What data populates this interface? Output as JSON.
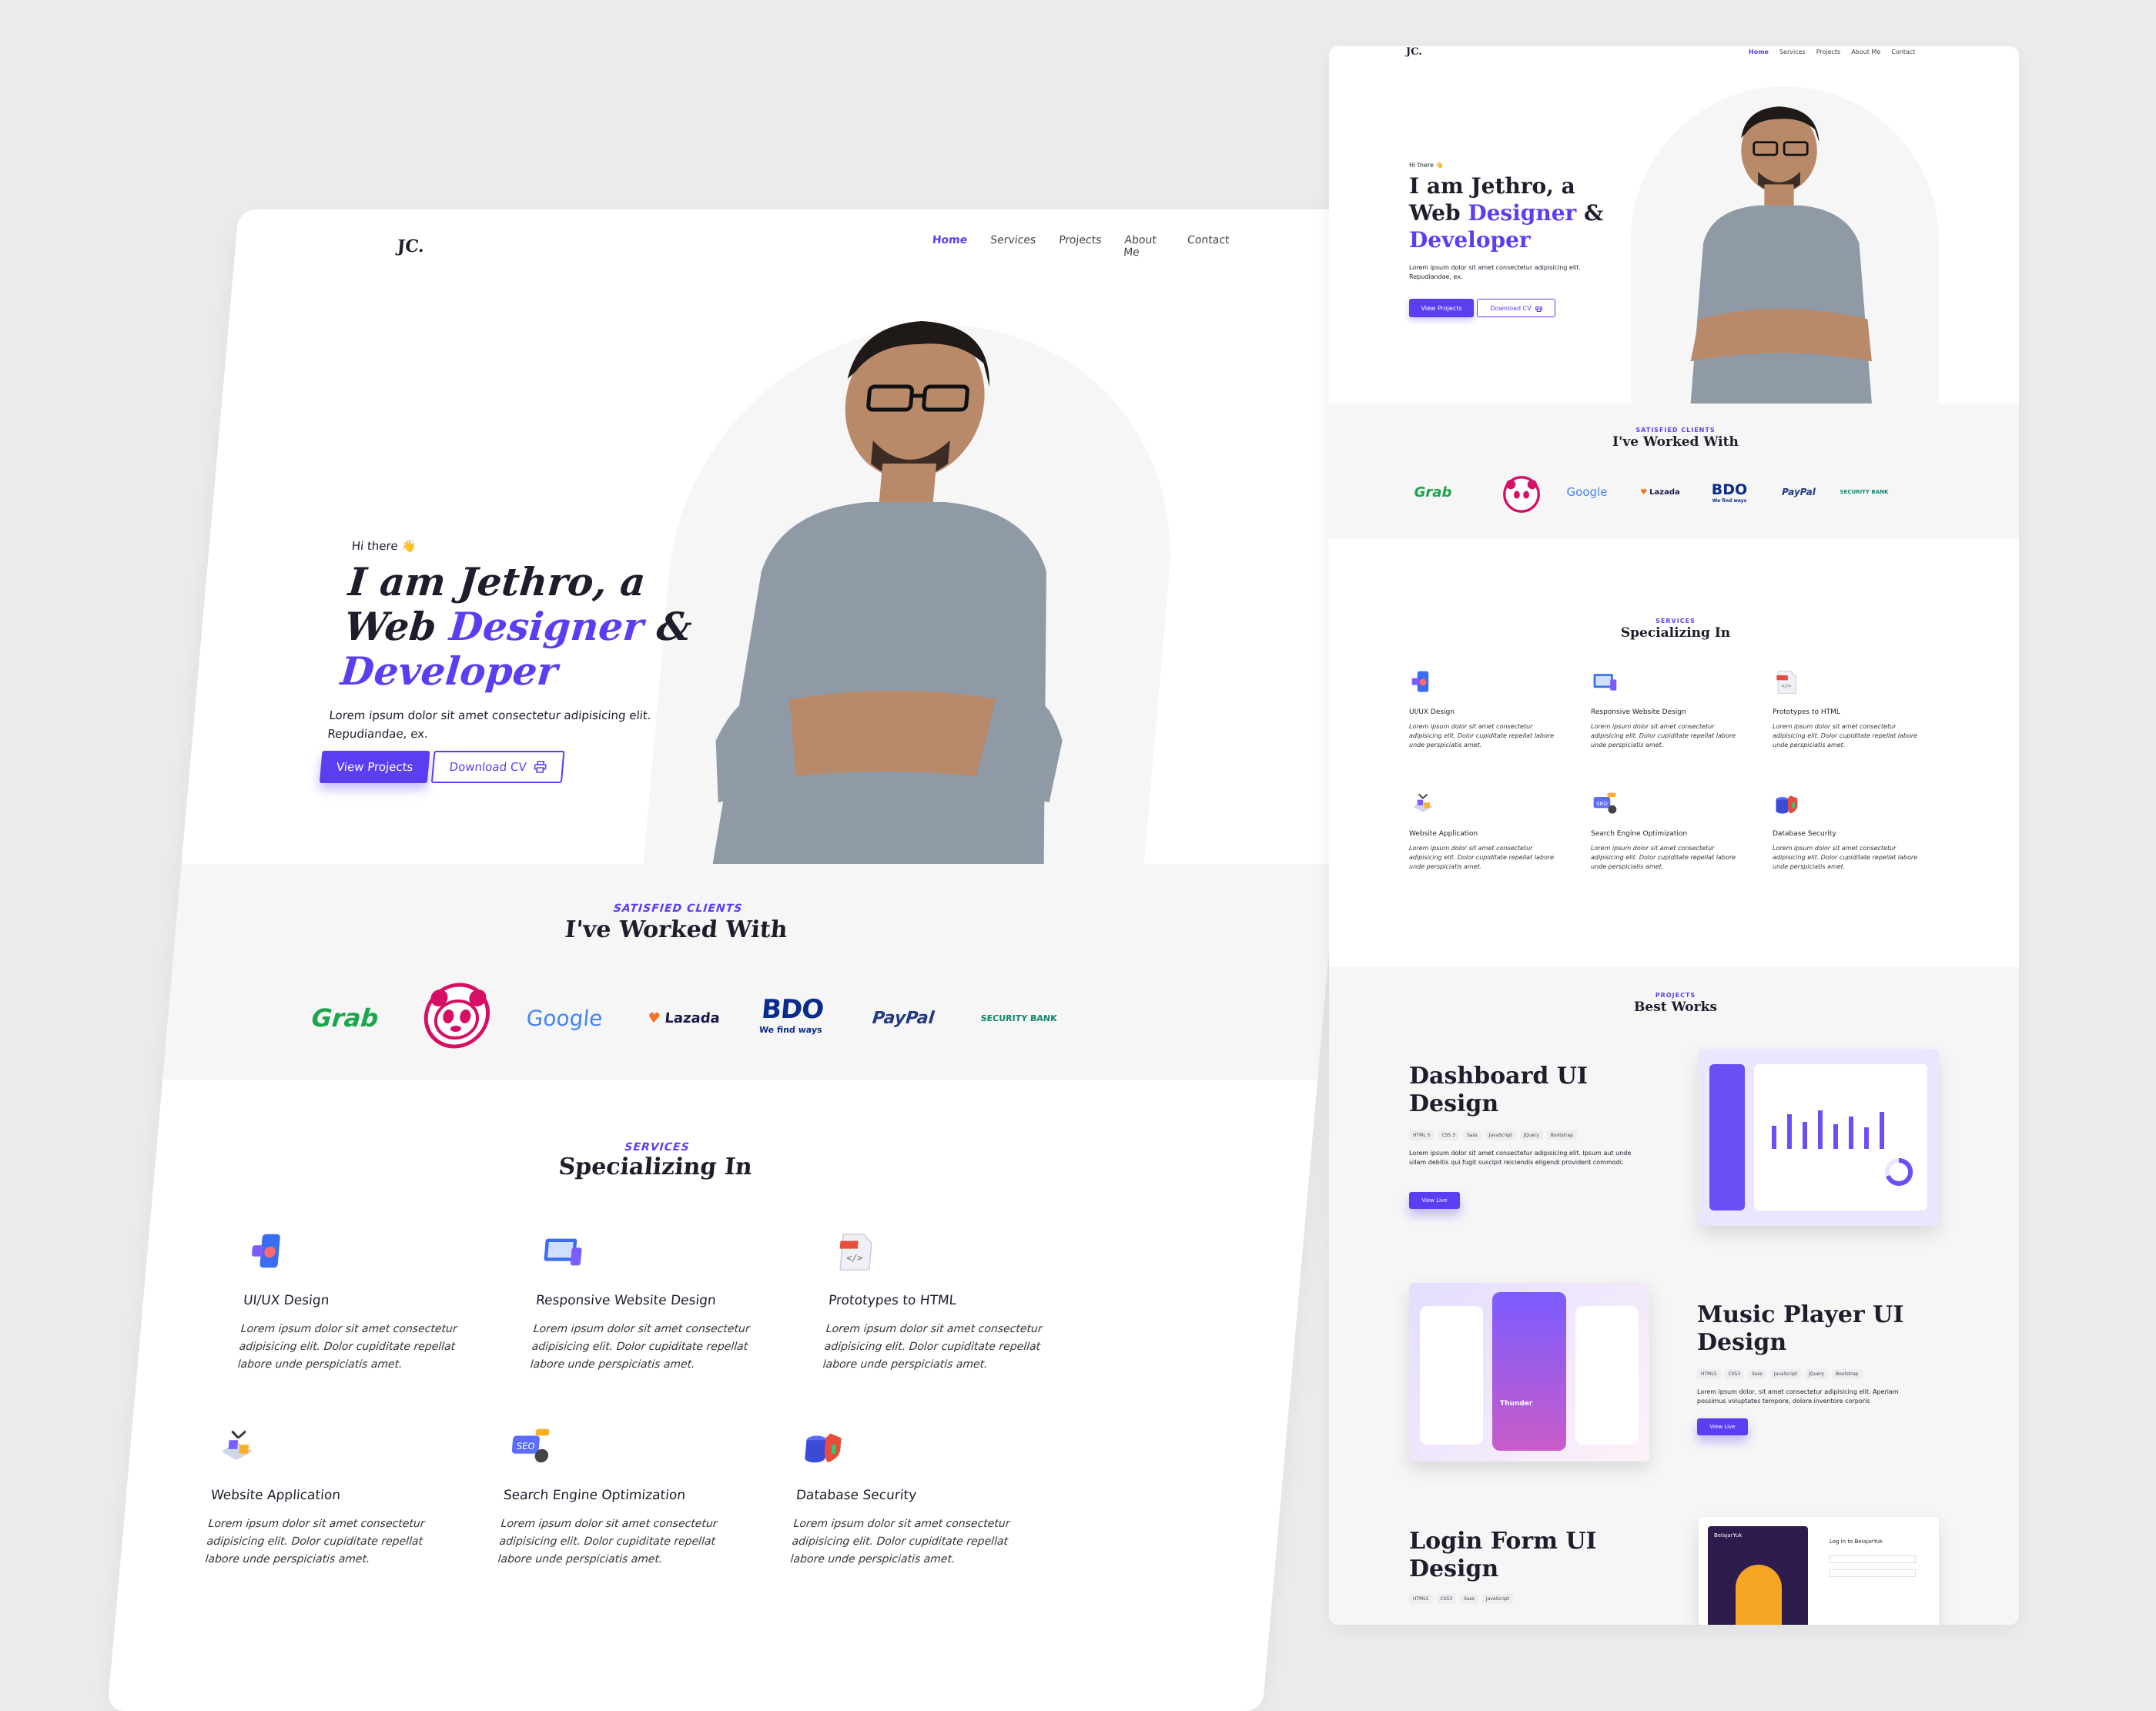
{
  "colors": {
    "accent": "#5b3ef2",
    "band": "#f6f6f7",
    "text": "#1d1d2b"
  },
  "brand": "JC.",
  "nav": {
    "items": [
      "Home",
      "Services",
      "Projects",
      "About Me",
      "Contact"
    ],
    "active": "Home"
  },
  "hero": {
    "greeting": "Hi there 👋",
    "line1": "I am Jethro, a",
    "line2_a": "Web ",
    "line2_b": "Designer",
    "line2_c": " &",
    "line3": "Developer",
    "description_1": "Lorem ipsum dolor sit amet consectetur adipisicing elit.",
    "description_2": "Repudiandae, ex.",
    "primary_button": "View Projects",
    "secondary_button": "Download CV",
    "secondary_icon": "printer-icon"
  },
  "clients": {
    "eyebrow": "SATISFIED CLIENTS",
    "title": "I've Worked With",
    "logos": [
      "Grab",
      "foodpanda",
      "Google",
      "Lazada",
      "BDO",
      "PayPal",
      "SECURITY BANK"
    ],
    "bdo_tagline": "We find ways"
  },
  "services": {
    "eyebrow": "SERVICES",
    "title": "Specializing In",
    "items": [
      {
        "title": "UI/UX Design",
        "icon": "mobile-design-icon",
        "desc": "Lorem ipsum dolor sit amet consectetur adipisicing elit. Dolor cupiditate repellat labore unde perspiciatis amet."
      },
      {
        "title": "Responsive Website Design",
        "icon": "responsive-devices-icon",
        "desc": "Lorem ipsum dolor sit amet consectetur adipisicing elit. Dolor cupiditate repellat labore unde perspiciatis amet."
      },
      {
        "title": "Prototypes to HTML",
        "icon": "html-file-icon",
        "desc": "Lorem ipsum dolor sit amet consectetur adipisicing elit. Dolor cupiditate repellat labore unde perspiciatis amet."
      },
      {
        "title": "Website Application",
        "icon": "web-app-icon",
        "desc": "Lorem ipsum dolor sit amet consectetur adipisicing elit. Dolor cupiditate repellat labore unde perspiciatis amet."
      },
      {
        "title": "Search Engine Optimization",
        "icon": "seo-icon",
        "desc": "Lorem ipsum dolor sit amet consectetur adipisicing elit. Dolor cupiditate repellat labore unde perspiciatis amet."
      },
      {
        "title": "Database Security",
        "icon": "database-security-icon",
        "desc": "Lorem ipsum dolor sit amet consectetur adipisicing elit. Dolor cupiditate repellat labore unde perspiciatis amet."
      }
    ]
  },
  "projects": {
    "eyebrow": "PROJECTS",
    "title": "Best Works",
    "items": [
      {
        "title_1": "Dashboard UI",
        "title_2": "Design",
        "tags": [
          "HTML 5",
          "CSS 3",
          "Sass",
          "JavaScript",
          "JQuery",
          "Bootstrap"
        ],
        "desc": "Lorem ipsum dolor sit amet consectetur adipisicing elit. Ipsum aut unde ullam debitis qui fugit suscipit reiciendis eligendi provident commodi.",
        "button": "View Live"
      },
      {
        "title_1": "Music Player UI",
        "title_2": "Design",
        "tags": [
          "HTML5",
          "CSS3",
          "Sass",
          "JavaScript",
          "JQuery",
          "Bootstrap"
        ],
        "desc": "Lorem ipsum dolor, sit amet consectetur adipisicing elit. Aperiam possimus voluptates tempore, dolore inventore corporis",
        "button": "View Live",
        "thumb_title": "Thunder"
      },
      {
        "title_1": "Login Form UI",
        "title_2": "Design",
        "tags": [
          "HTML5",
          "CSS3",
          "Sass",
          "JavaScript"
        ],
        "thumb_title": "BelajarYuk",
        "thumb_login": "Log in to BelajarYuk"
      }
    ]
  }
}
